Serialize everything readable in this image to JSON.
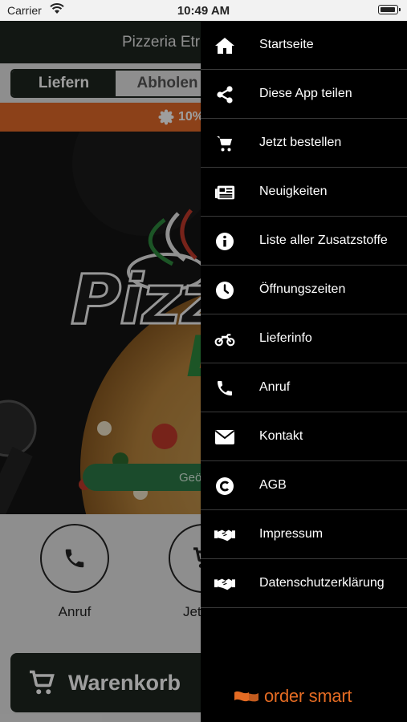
{
  "status_bar": {
    "carrier": "Carrier",
    "time": "10:49 AM"
  },
  "app": {
    "title": "Pizzeria Etr",
    "mode_toggle": {
      "deliver": "Liefern",
      "pickup": "Abholen"
    },
    "promo_text": "10%",
    "hero_logo_text": "Pizz",
    "hero_logo_text2": "E",
    "hours_button": "Geö",
    "quick_actions": [
      {
        "label": "Anruf",
        "icon": "phone-icon"
      },
      {
        "label": "Jetzt b",
        "icon": "cart-icon"
      }
    ],
    "cart_button": "Warenkorb"
  },
  "drawer": {
    "items": [
      {
        "label": "Startseite",
        "icon": "home-icon"
      },
      {
        "label": "Diese App teilen",
        "icon": "share-icon"
      },
      {
        "label": "Jetzt bestellen",
        "icon": "cart-icon"
      },
      {
        "label": "Neuigkeiten",
        "icon": "newspaper-icon"
      },
      {
        "label": "Liste aller Zusatzstoffe",
        "icon": "info-icon"
      },
      {
        "label": "Öffnungszeiten",
        "icon": "clock-icon"
      },
      {
        "label": "Lieferinfo",
        "icon": "motorcycle-icon"
      },
      {
        "label": "Anruf",
        "icon": "phone-icon"
      },
      {
        "label": "Kontakt",
        "icon": "envelope-icon"
      },
      {
        "label": "AGB",
        "icon": "copyright-icon"
      },
      {
        "label": "Impressum",
        "icon": "handshake-icon"
      },
      {
        "label": "Datenschutzerklärung",
        "icon": "handshake-icon"
      }
    ],
    "brand": "order smart"
  },
  "colors": {
    "header": "#1d2620",
    "promo": "#e36a29",
    "drawer_bg": "#000000",
    "brand": "#e46b23",
    "hours_button": "#2d7a47"
  }
}
